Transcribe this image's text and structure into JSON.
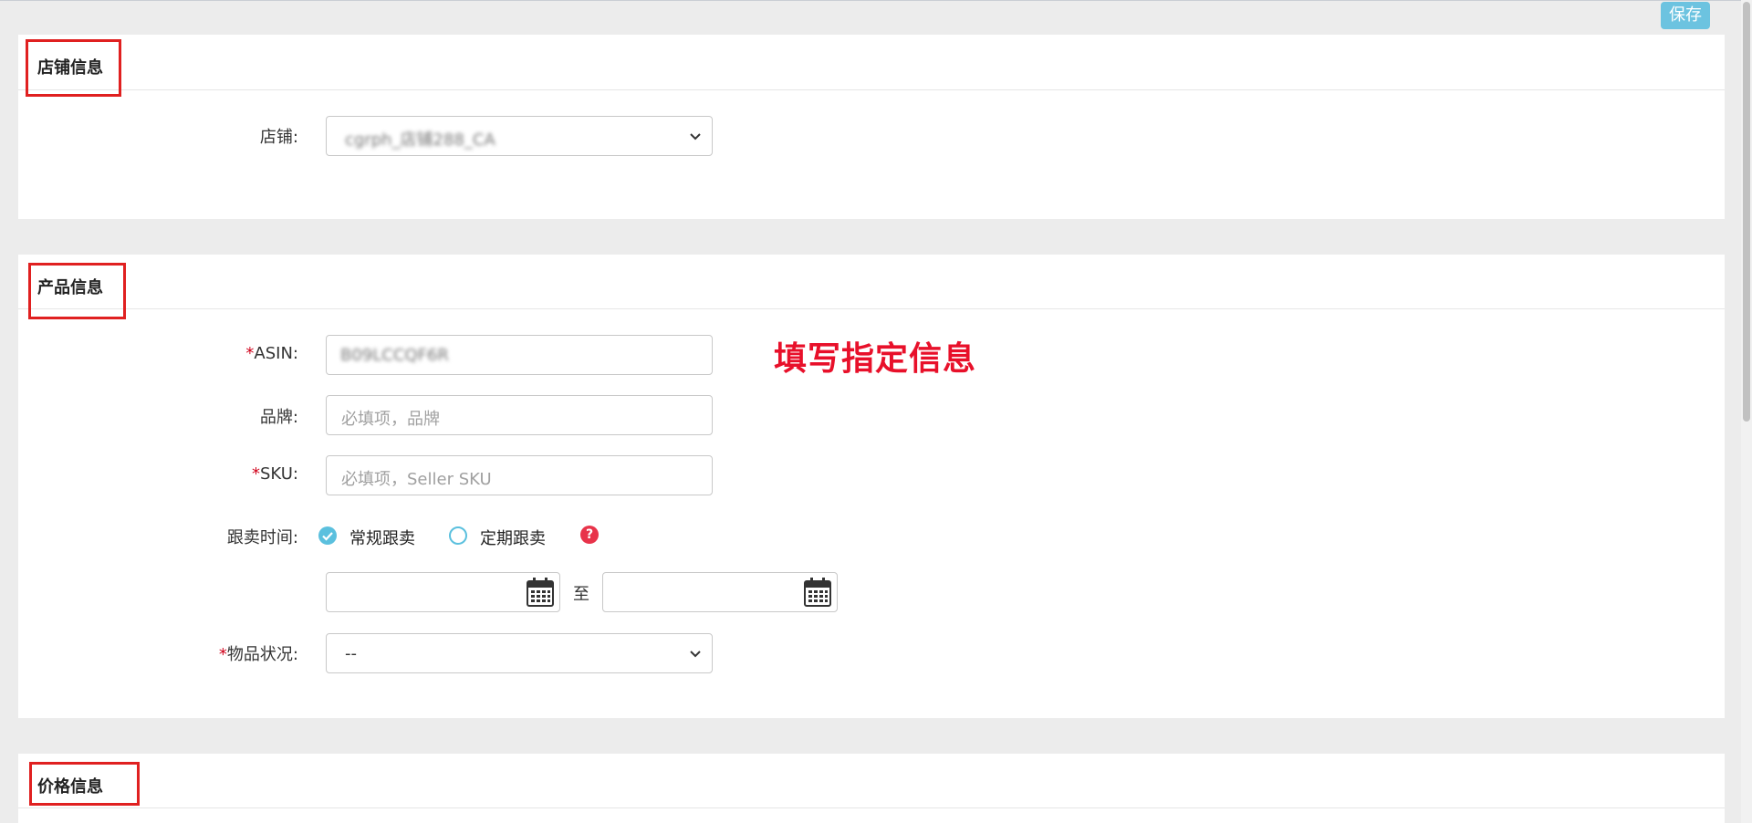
{
  "toolbar": {
    "save_label": "保存"
  },
  "shop_section": {
    "title": "店铺信息",
    "shop_label": "店铺:",
    "shop_value": "cgrph_店铺288_CA"
  },
  "product_section": {
    "title": "产品信息",
    "asin_label": "ASIN:",
    "asin_value": "B09LCCQF6R",
    "brand_label": "品牌:",
    "brand_placeholder": "必填项，品牌",
    "sku_label": "SKU:",
    "sku_placeholder": "必填项，Seller SKU",
    "follow_time_label": "跟卖时间:",
    "option_regular": "常规跟卖",
    "option_scheduled": "定期跟卖",
    "help_glyph": "?",
    "date_separator": "至",
    "condition_label": "物品状况:",
    "condition_value": "--",
    "required_mark": "*"
  },
  "price_section": {
    "title": "价格信息"
  },
  "annotation": {
    "text": "填写指定信息"
  },
  "colors": {
    "accent": "#5bc0de",
    "save_button": "#6cc3e0",
    "highlight_red": "#e02020",
    "help_icon": "#e8334a"
  },
  "icons": [
    "chevron-down-icon",
    "calendar-icon",
    "check-icon",
    "question-icon"
  ]
}
